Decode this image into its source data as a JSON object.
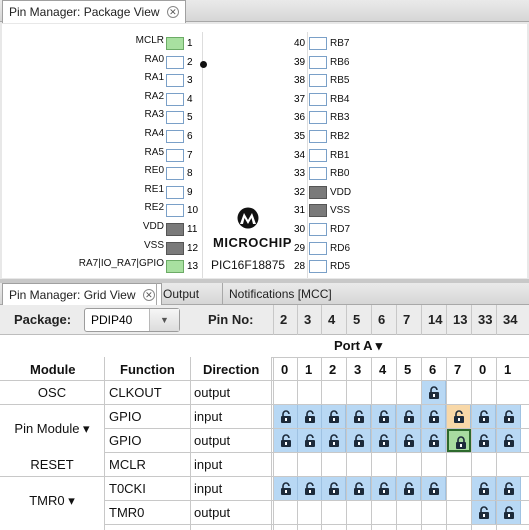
{
  "top_tabs": [
    {
      "label": "Pin Manager: Package View"
    }
  ],
  "package_view": {
    "left_pins": [
      {
        "name": "MCLR",
        "num": "1",
        "state": "green"
      },
      {
        "name": "RA0",
        "num": "2",
        "state": "white"
      },
      {
        "name": "RA1",
        "num": "3",
        "state": "white"
      },
      {
        "name": "RA2",
        "num": "4",
        "state": "white"
      },
      {
        "name": "RA3",
        "num": "5",
        "state": "white"
      },
      {
        "name": "RA4",
        "num": "6",
        "state": "white"
      },
      {
        "name": "RA5",
        "num": "7",
        "state": "white"
      },
      {
        "name": "RE0",
        "num": "8",
        "state": "white"
      },
      {
        "name": "RE1",
        "num": "9",
        "state": "white"
      },
      {
        "name": "RE2",
        "num": "10",
        "state": "white"
      },
      {
        "name": "VDD",
        "num": "11",
        "state": "gray"
      },
      {
        "name": "VSS",
        "num": "12",
        "state": "gray"
      },
      {
        "name": "RA7|IO_RA7|GPIO",
        "num": "13",
        "state": "green"
      }
    ],
    "right_pins": [
      {
        "name": "RB7",
        "num": "40",
        "state": "white"
      },
      {
        "name": "RB6",
        "num": "39",
        "state": "white"
      },
      {
        "name": "RB5",
        "num": "38",
        "state": "white"
      },
      {
        "name": "RB4",
        "num": "37",
        "state": "white"
      },
      {
        "name": "RB3",
        "num": "36",
        "state": "white"
      },
      {
        "name": "RB2",
        "num": "35",
        "state": "white"
      },
      {
        "name": "RB1",
        "num": "34",
        "state": "white"
      },
      {
        "name": "RB0",
        "num": "33",
        "state": "white"
      },
      {
        "name": "VDD",
        "num": "32",
        "state": "gray"
      },
      {
        "name": "VSS",
        "num": "31",
        "state": "gray"
      },
      {
        "name": "RD7",
        "num": "30",
        "state": "white"
      },
      {
        "name": "RD6",
        "num": "29",
        "state": "white"
      },
      {
        "name": "RD5",
        "num": "28",
        "state": "white"
      }
    ],
    "brand": "MICROCHIP",
    "part": "PIC16F18875"
  },
  "bottom_tabs": [
    {
      "label": "Pin Manager: Grid View",
      "active": true
    },
    {
      "label": "Output",
      "active": false
    },
    {
      "label": "Notifications [MCC]",
      "active": false
    }
  ],
  "toolbar": {
    "package_label": "Package:",
    "package_value": "PDIP40",
    "pin_no_label": "Pin No:",
    "pin_numbers": [
      "2",
      "3",
      "4",
      "5",
      "6",
      "7",
      "14",
      "13",
      "33",
      "34"
    ]
  },
  "grid": {
    "port_label": "Port A ▾",
    "headers": {
      "module": "Module",
      "function": "Function",
      "direction": "Direction"
    },
    "bit_numbers": [
      "0",
      "1",
      "2",
      "3",
      "4",
      "5",
      "6",
      "7",
      "0",
      "1"
    ],
    "rows": [
      {
        "module": "OSC",
        "function": "CLKOUT",
        "direction": "output",
        "locks": [
          "",
          "",
          "",
          "",
          "",
          "",
          "blue",
          "",
          "",
          ""
        ]
      },
      {
        "module": "Pin Module ▾",
        "function": "GPIO",
        "direction": "input",
        "locks": [
          "blue",
          "blue",
          "blue",
          "blue",
          "blue",
          "blue",
          "blue",
          "orange",
          "blue",
          "blue"
        ]
      },
      {
        "module": "",
        "function": "GPIO",
        "direction": "output",
        "locks": [
          "blue",
          "blue",
          "blue",
          "blue",
          "blue",
          "blue",
          "blue",
          "green",
          "blue",
          "blue"
        ]
      },
      {
        "module": "RESET",
        "function": "MCLR",
        "direction": "input",
        "locks": [
          "",
          "",
          "",
          "",
          "",
          "",
          "",
          "",
          "",
          ""
        ]
      },
      {
        "module": "TMR0 ▾",
        "function": "T0CKI",
        "direction": "input",
        "locks": [
          "blue",
          "blue",
          "blue",
          "blue",
          "blue",
          "blue",
          "blue",
          "",
          "blue",
          "blue"
        ]
      },
      {
        "module": "",
        "function": "TMR0",
        "direction": "output",
        "locks": [
          "",
          "",
          "",
          "",
          "",
          "",
          "",
          "",
          "blue",
          "blue"
        ]
      }
    ]
  },
  "colors": {
    "lock_blue": "#b8d8f4",
    "lock_orange": "#f8d8a8",
    "lock_green": "#a8dca0",
    "pin_green": "#a8e0a0",
    "pin_gray": "#7a7a7a"
  }
}
